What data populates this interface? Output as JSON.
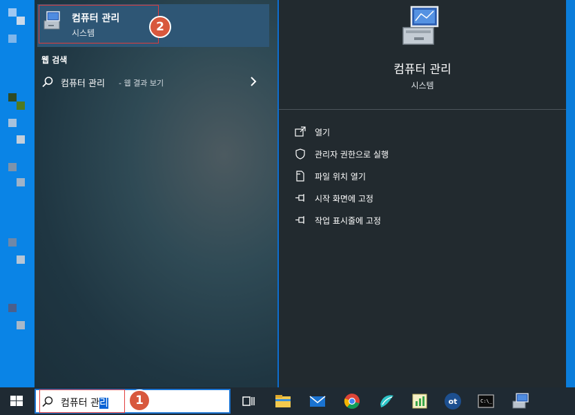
{
  "best_match": {
    "title": "컴퓨터 관리",
    "subtitle": "시스템",
    "callout_number": "2"
  },
  "web_section": {
    "header": "웹 검색",
    "query": "컴퓨터 관리",
    "suffix": "- 웹 결과 보기"
  },
  "detail": {
    "title": "컴퓨터 관리",
    "subtitle": "시스템",
    "actions": [
      {
        "label": "열기",
        "icon": "open-icon"
      },
      {
        "label": "관리자 권한으로 실행",
        "icon": "shield-icon"
      },
      {
        "label": "파일 위치 열기",
        "icon": "file-location-icon"
      },
      {
        "label": "시작 화면에 고정",
        "icon": "pin-icon"
      },
      {
        "label": "작업 표시줄에 고정",
        "icon": "pin-icon"
      }
    ]
  },
  "taskbar": {
    "search_text_plain": "컴퓨터 관",
    "search_text_selected": "리",
    "callout_number": "1",
    "apps": [
      "task-view-icon",
      "file-explorer-icon",
      "mail-icon",
      "chrome-icon",
      "app-icon",
      "notepad-icon",
      "ot-icon",
      "terminal-icon",
      "computer-management-icon"
    ],
    "ot_label": "ot",
    "terminal_label": "C:\\_"
  },
  "colors": {
    "accent_blue": "#1a73d1",
    "callout_red": "#e23b3b",
    "badge_orange": "#d8583d",
    "selected_bg": "#2e5675"
  }
}
